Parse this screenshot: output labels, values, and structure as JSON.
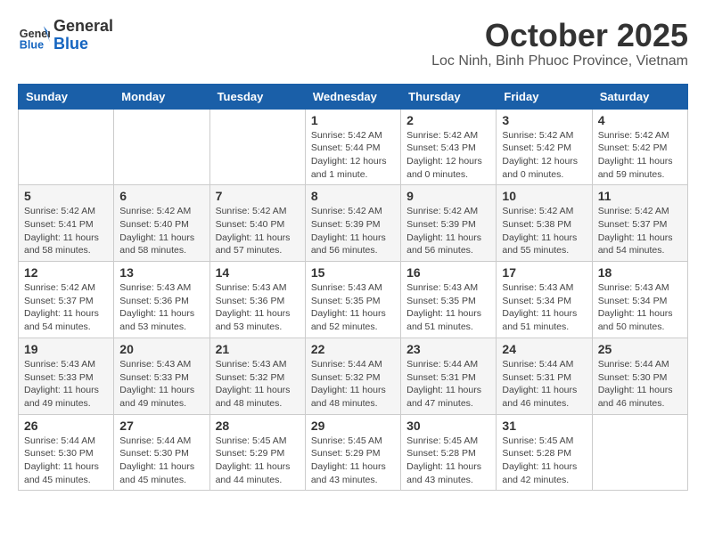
{
  "header": {
    "logo_general": "General",
    "logo_blue": "Blue",
    "month": "October 2025",
    "location": "Loc Ninh, Binh Phuoc Province, Vietnam"
  },
  "weekdays": [
    "Sunday",
    "Monday",
    "Tuesday",
    "Wednesday",
    "Thursday",
    "Friday",
    "Saturday"
  ],
  "weeks": [
    [
      {
        "day": "",
        "info": ""
      },
      {
        "day": "",
        "info": ""
      },
      {
        "day": "",
        "info": ""
      },
      {
        "day": "1",
        "info": "Sunrise: 5:42 AM\nSunset: 5:44 PM\nDaylight: 12 hours\nand 1 minute."
      },
      {
        "day": "2",
        "info": "Sunrise: 5:42 AM\nSunset: 5:43 PM\nDaylight: 12 hours\nand 0 minutes."
      },
      {
        "day": "3",
        "info": "Sunrise: 5:42 AM\nSunset: 5:42 PM\nDaylight: 12 hours\nand 0 minutes."
      },
      {
        "day": "4",
        "info": "Sunrise: 5:42 AM\nSunset: 5:42 PM\nDaylight: 11 hours\nand 59 minutes."
      }
    ],
    [
      {
        "day": "5",
        "info": "Sunrise: 5:42 AM\nSunset: 5:41 PM\nDaylight: 11 hours\nand 58 minutes."
      },
      {
        "day": "6",
        "info": "Sunrise: 5:42 AM\nSunset: 5:40 PM\nDaylight: 11 hours\nand 58 minutes."
      },
      {
        "day": "7",
        "info": "Sunrise: 5:42 AM\nSunset: 5:40 PM\nDaylight: 11 hours\nand 57 minutes."
      },
      {
        "day": "8",
        "info": "Sunrise: 5:42 AM\nSunset: 5:39 PM\nDaylight: 11 hours\nand 56 minutes."
      },
      {
        "day": "9",
        "info": "Sunrise: 5:42 AM\nSunset: 5:39 PM\nDaylight: 11 hours\nand 56 minutes."
      },
      {
        "day": "10",
        "info": "Sunrise: 5:42 AM\nSunset: 5:38 PM\nDaylight: 11 hours\nand 55 minutes."
      },
      {
        "day": "11",
        "info": "Sunrise: 5:42 AM\nSunset: 5:37 PM\nDaylight: 11 hours\nand 54 minutes."
      }
    ],
    [
      {
        "day": "12",
        "info": "Sunrise: 5:42 AM\nSunset: 5:37 PM\nDaylight: 11 hours\nand 54 minutes."
      },
      {
        "day": "13",
        "info": "Sunrise: 5:43 AM\nSunset: 5:36 PM\nDaylight: 11 hours\nand 53 minutes."
      },
      {
        "day": "14",
        "info": "Sunrise: 5:43 AM\nSunset: 5:36 PM\nDaylight: 11 hours\nand 53 minutes."
      },
      {
        "day": "15",
        "info": "Sunrise: 5:43 AM\nSunset: 5:35 PM\nDaylight: 11 hours\nand 52 minutes."
      },
      {
        "day": "16",
        "info": "Sunrise: 5:43 AM\nSunset: 5:35 PM\nDaylight: 11 hours\nand 51 minutes."
      },
      {
        "day": "17",
        "info": "Sunrise: 5:43 AM\nSunset: 5:34 PM\nDaylight: 11 hours\nand 51 minutes."
      },
      {
        "day": "18",
        "info": "Sunrise: 5:43 AM\nSunset: 5:34 PM\nDaylight: 11 hours\nand 50 minutes."
      }
    ],
    [
      {
        "day": "19",
        "info": "Sunrise: 5:43 AM\nSunset: 5:33 PM\nDaylight: 11 hours\nand 49 minutes."
      },
      {
        "day": "20",
        "info": "Sunrise: 5:43 AM\nSunset: 5:33 PM\nDaylight: 11 hours\nand 49 minutes."
      },
      {
        "day": "21",
        "info": "Sunrise: 5:43 AM\nSunset: 5:32 PM\nDaylight: 11 hours\nand 48 minutes."
      },
      {
        "day": "22",
        "info": "Sunrise: 5:44 AM\nSunset: 5:32 PM\nDaylight: 11 hours\nand 48 minutes."
      },
      {
        "day": "23",
        "info": "Sunrise: 5:44 AM\nSunset: 5:31 PM\nDaylight: 11 hours\nand 47 minutes."
      },
      {
        "day": "24",
        "info": "Sunrise: 5:44 AM\nSunset: 5:31 PM\nDaylight: 11 hours\nand 46 minutes."
      },
      {
        "day": "25",
        "info": "Sunrise: 5:44 AM\nSunset: 5:30 PM\nDaylight: 11 hours\nand 46 minutes."
      }
    ],
    [
      {
        "day": "26",
        "info": "Sunrise: 5:44 AM\nSunset: 5:30 PM\nDaylight: 11 hours\nand 45 minutes."
      },
      {
        "day": "27",
        "info": "Sunrise: 5:44 AM\nSunset: 5:30 PM\nDaylight: 11 hours\nand 45 minutes."
      },
      {
        "day": "28",
        "info": "Sunrise: 5:45 AM\nSunset: 5:29 PM\nDaylight: 11 hours\nand 44 minutes."
      },
      {
        "day": "29",
        "info": "Sunrise: 5:45 AM\nSunset: 5:29 PM\nDaylight: 11 hours\nand 43 minutes."
      },
      {
        "day": "30",
        "info": "Sunrise: 5:45 AM\nSunset: 5:28 PM\nDaylight: 11 hours\nand 43 minutes."
      },
      {
        "day": "31",
        "info": "Sunrise: 5:45 AM\nSunset: 5:28 PM\nDaylight: 11 hours\nand 42 minutes."
      },
      {
        "day": "",
        "info": ""
      }
    ]
  ]
}
